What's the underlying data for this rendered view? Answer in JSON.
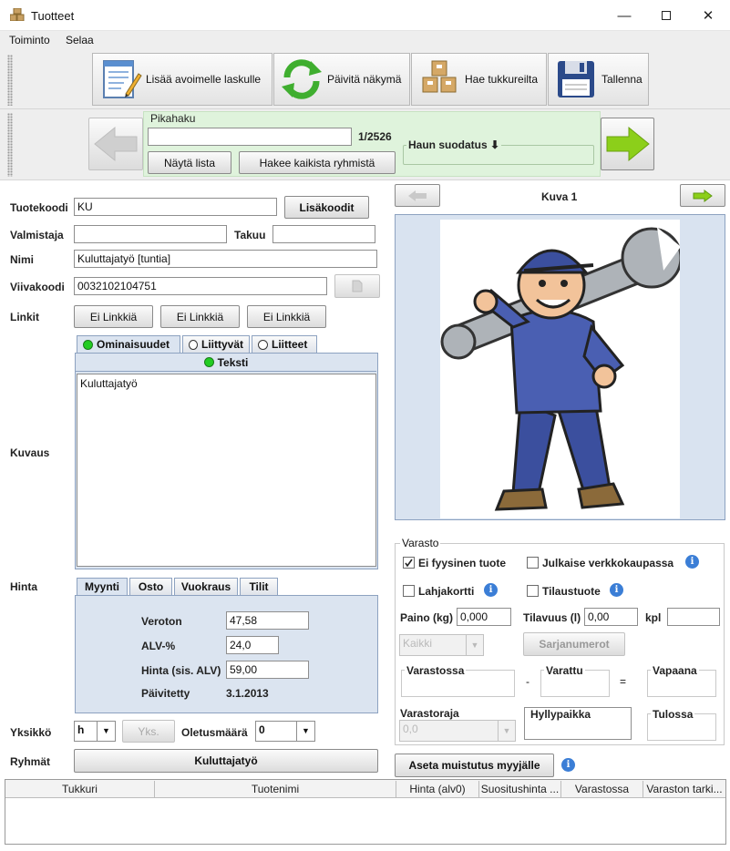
{
  "window": {
    "title": "Tuotteet",
    "icon": "boxes-icon",
    "controls": [
      "minimize-icon",
      "maximize-icon",
      "close-icon"
    ]
  },
  "menu": {
    "items": [
      "Toiminto",
      "Selaa"
    ]
  },
  "toolbar": {
    "add_to_invoice": "Lisää avoimelle laskulle",
    "refresh": "Päivitä näkymä",
    "fetch_wholesalers": "Hae tukkureilta",
    "save": "Tallenna"
  },
  "quicksearch": {
    "title": "Pikahaku",
    "value": "",
    "counter": "1/2526",
    "show_list": "Näytä lista",
    "search_all": "Hakee kaikista ryhmistä",
    "filter_title": "Haun suodatus"
  },
  "product": {
    "code_label": "Tuotekoodi",
    "code": "KU",
    "more_codes": "Lisäkoodit",
    "maker_label": "Valmistaja",
    "maker": "",
    "warranty_label": "Takuu",
    "warranty": "",
    "name_label": "Nimi",
    "name": "Kuluttajatyö [tuntia]",
    "barcode_label": "Viivakoodi",
    "barcode": "0032102104751",
    "links_label": "Linkit",
    "link1": "Ei Linkkiä",
    "link2": "Ei Linkkiä",
    "link3": "Ei Linkkiä",
    "desc_tabs": [
      "Ominaisuudet",
      "Liittyvät",
      "Liitteet"
    ],
    "text_tab": "Teksti",
    "desc_label": "Kuvaus",
    "description": "Kuluttajatyö"
  },
  "price": {
    "label": "Hinta",
    "tabs": [
      "Myynti",
      "Osto",
      "Vuokraus",
      "Tilit"
    ],
    "net_label": "Veroton",
    "net": "47,58",
    "vat_label": "ALV-%",
    "vat": "24,0",
    "gross_label": "Hinta (sis. ALV)",
    "gross": "59,00",
    "updated_label": "Päivitetty",
    "updated": "3.1.2013"
  },
  "unit": {
    "label": "Yksikkö",
    "value": "h",
    "units_button": "Yks.",
    "default_qty_label": "Oletusmäärä",
    "default_qty": "0"
  },
  "groups": {
    "label": "Ryhmät",
    "value": "Kuluttajatyö"
  },
  "image": {
    "caption": "Kuva 1",
    "subject": "mechanic-with-wrench-illustration"
  },
  "stock": {
    "title": "Varasto",
    "non_physical": "Ei fyysinen tuote",
    "non_physical_checked": true,
    "publish_web": "Julkaise verkkokaupassa",
    "publish_web_checked": false,
    "gift_card": "Lahjakortti",
    "gift_card_checked": false,
    "order_item": "Tilaustuote",
    "order_item_checked": false,
    "weight_label": "Paino (kg)",
    "weight": "0,000",
    "volume_label": "Tilavuus (l)",
    "volume": "0,00",
    "pcs_label": "kpl",
    "pcs": "",
    "all_select": "Kaikki",
    "serials": "Sarjanumerot",
    "in_stock": "Varastossa",
    "minus": "-",
    "reserved": "Varattu",
    "equals": "=",
    "free": "Vapaana",
    "limit_label": "Varastoraja",
    "limit": "0,0",
    "shelf_label": "Hyllypaikka",
    "incoming_label": "Tulossa"
  },
  "reminder": {
    "label": "Aseta muistutus myyjälle"
  },
  "table": {
    "columns": [
      "Tukkuri",
      "Tuotenimi",
      "Hinta (alv0)",
      "Suositushinta ...",
      "Varastossa",
      "Varaston tarki..."
    ]
  },
  "colors": {
    "accent_green": "#22cc22",
    "panel_blue": "#dbe4f0",
    "quicksearch_bg": "#dff3dc",
    "arrow_green": "#8ccf1a"
  }
}
